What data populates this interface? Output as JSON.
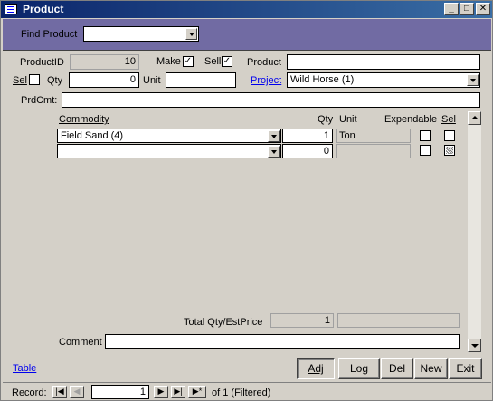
{
  "window": {
    "title": "Product",
    "controls": [
      "_",
      "□",
      "✕"
    ]
  },
  "header": {
    "find_label": "Find Product",
    "find_value": ""
  },
  "fields": {
    "productid_label": "ProductID",
    "productid_value": "10",
    "make_label": "Make",
    "make_checked": "✓",
    "sell_label": "Sell",
    "sell_checked": "✓",
    "product_label": "Product",
    "product_value": "",
    "sel_label": "Sel",
    "qty_label": "Qty",
    "qty_value": "0",
    "unit_label": "Unit",
    "unit_value": "",
    "project_label": "Project",
    "project_value": "Wild Horse (1)",
    "prdcmt_label": "PrdCmt:",
    "prdcmt_value": ""
  },
  "subform": {
    "headers": {
      "commodity": "Commodity",
      "qty": "Qty",
      "unit": "Unit",
      "expendable": "Expendable",
      "sel": "Sel"
    },
    "rows": [
      {
        "commodity": "Field Sand (4)",
        "qty": "1",
        "unit": "Ton"
      },
      {
        "commodity": "",
        "qty": "0",
        "unit": ""
      }
    ],
    "total_label": "Total Qty/EstPrice",
    "total_qty": "1",
    "total_price": "",
    "comment_label": "Comment",
    "comment_value": ""
  },
  "footer": {
    "table_link": "Table",
    "buttons": {
      "adj": "Adj",
      "log": "Log",
      "del": "Del",
      "new": "New",
      "exit": "Exit"
    }
  },
  "nav": {
    "record_label": "Record:",
    "current": "1",
    "of_text": "of  1 (Filtered)"
  },
  "colors": {
    "title_bar": "#0a246a",
    "header_band": "#716ba3",
    "form_bg": "#d4d0c8",
    "link": "#0000ee"
  }
}
